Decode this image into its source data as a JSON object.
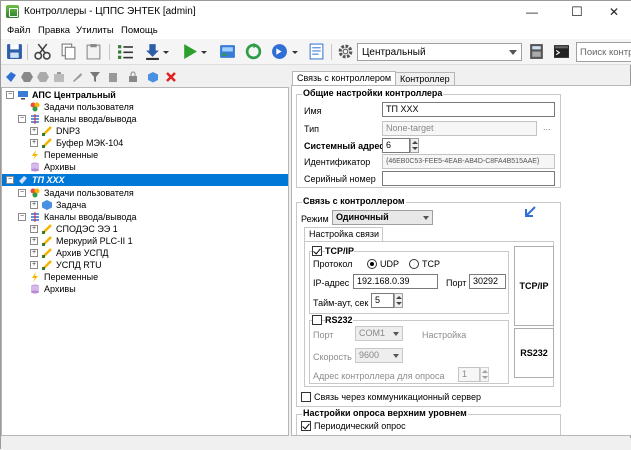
{
  "window": {
    "title": "Контроллеры - ЦППС ЭНТЕК [admin]",
    "minimize_glyph": "—",
    "maximize_glyph": "☐",
    "close_glyph": "✕"
  },
  "menu": [
    "Файл",
    "Правка",
    "Утилиты",
    "Помощь"
  ],
  "toolbar": {
    "server_combo_value": "Центральный",
    "search_placeholder": "Поиск контр"
  },
  "tree": [
    {
      "label": "АПС Центральный",
      "style": "bold",
      "icon": "computer-icon",
      "expander": "−"
    },
    {
      "label": "Задачи пользователя",
      "icon": "tasks-icon"
    },
    {
      "label": "Каналы ввода/вывода",
      "icon": "channels-icon",
      "expander": "−"
    },
    {
      "label": "DNP3",
      "icon": "channel-plug-icon",
      "expander": "+"
    },
    {
      "label": "Буфер МЭК-104",
      "icon": "channel-plug-icon",
      "expander": "+"
    },
    {
      "label": "Переменные",
      "icon": "variables-icon"
    },
    {
      "label": "Архивы",
      "icon": "archive-icon"
    },
    {
      "label": "ТП ХХХ",
      "style": "bolditalic",
      "icon": "controller-icon",
      "expander": "−",
      "selected": true
    },
    {
      "label": "Задачи пользователя",
      "icon": "tasks-icon",
      "expander": "−"
    },
    {
      "label": "Задача",
      "icon": "task-icon",
      "expander": "+"
    },
    {
      "label": "Каналы ввода/вывода",
      "icon": "channels-icon",
      "expander": "−"
    },
    {
      "label": "СПОДЭС ЭЭ 1",
      "icon": "channel-plug-icon",
      "expander": "+"
    },
    {
      "label": "Меркурий PLC-II 1",
      "icon": "channel-plug-icon",
      "expander": "+"
    },
    {
      "label": "Архив УСПД",
      "icon": "channel-plug-icon",
      "expander": "+"
    },
    {
      "label": "УСПД RTU",
      "icon": "channel-plug-icon",
      "expander": "+"
    },
    {
      "label": "Переменные",
      "icon": "variables-icon"
    },
    {
      "label": "Архивы",
      "icon": "archive-icon"
    }
  ],
  "tabs": [
    "Связь с контроллером",
    "Контроллер"
  ],
  "general": {
    "title": "Общие настройки контроллера",
    "name_label": "Имя",
    "name_value": "ТП ХХХ",
    "type_label": "Тип",
    "type_value": "None-target",
    "type_browse": "...",
    "sysaddr_label": "Системный адрес",
    "sysaddr_value": "6",
    "id_label": "Идентификатор",
    "id_value": "{46EB0C53-FEE5-4EAB-AB4D-C8FA4B515AAE}",
    "serial_label": "Серийный номер",
    "serial_value": ""
  },
  "link": {
    "title": "Связь с контроллером",
    "mode_label": "Режим",
    "mode_value": "Одиночный",
    "subtab": "Настройка связи",
    "tcp": {
      "title": "TCP/IP",
      "checked": true,
      "protocol_label": "Протокол",
      "udp_label": "UDP",
      "tcp_label": "TCP",
      "ip_label": "IP-адрес",
      "ip_value": "192.168.0.39",
      "port_label": "Порт",
      "port_value": "30292",
      "timeout_label": "Тайм-аут, сек",
      "timeout_value": "5",
      "side_button": "TCP/IP"
    },
    "rs232": {
      "title": "RS232",
      "checked": false,
      "port_label": "Порт",
      "port_value": "COM1",
      "settings_label": "Настройка",
      "speed_label": "Скорость",
      "speed_value": "9600",
      "addr_label": "Адрес контроллера для опроса",
      "addr_value": "1",
      "side_button": "RS232"
    },
    "comm_server_label": "Связь через коммуникационный сервер",
    "comm_server_checked": false
  },
  "polling": {
    "title": "Настройки опроса верхним уровнем",
    "periodic_label": "Периодический опрос",
    "periodic_checked": true
  },
  "colors": {
    "selection": "#0078d7",
    "play_green": "#2ca02c",
    "delete_red": "#e02020"
  }
}
